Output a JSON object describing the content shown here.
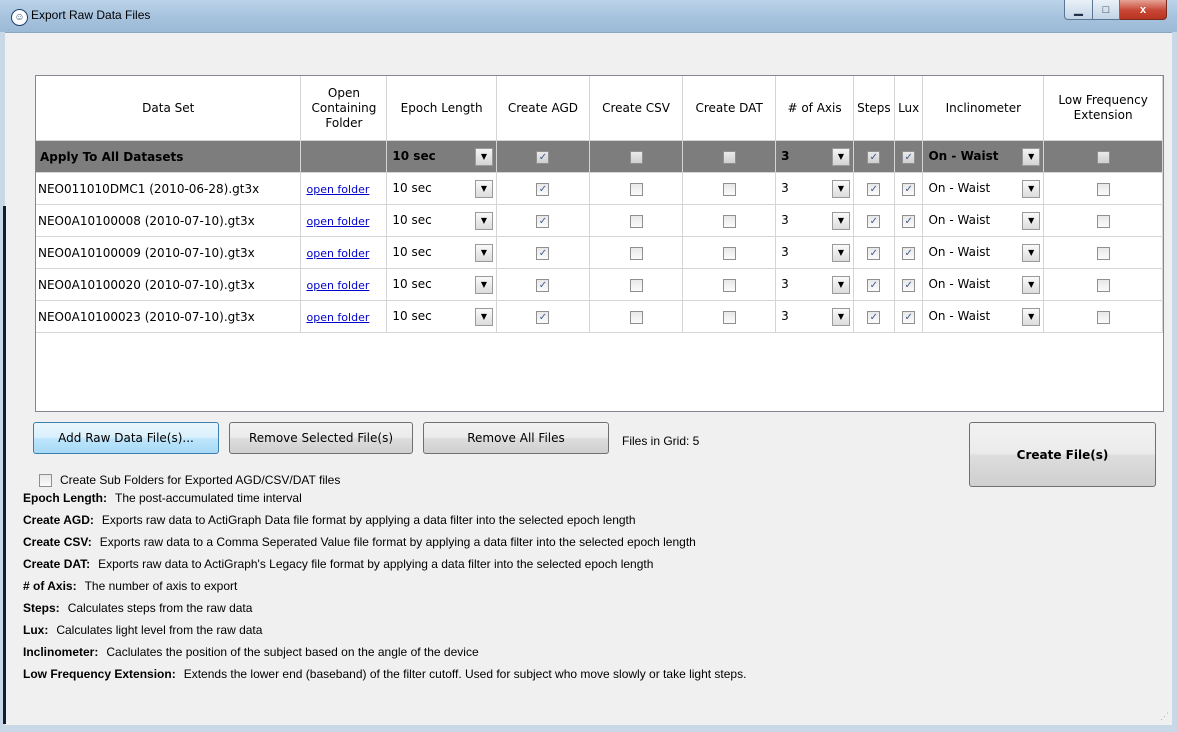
{
  "window": {
    "title": "Export Raw Data Files",
    "buttons": {
      "minimize": "▁",
      "maximize": "□",
      "close": "x"
    }
  },
  "grid": {
    "columns": [
      "Data Set",
      "Open Containing Folder",
      "Epoch Length",
      "Create AGD",
      "Create CSV",
      "Create DAT",
      "# of Axis",
      "Steps",
      "Lux",
      "Inclinometer",
      "Low Frequency Extension"
    ],
    "apply_row": {
      "name": "Apply To All Datasets",
      "epoch": "10 sec",
      "agd": true,
      "csv": false,
      "dat": false,
      "axis": "3",
      "steps": true,
      "lux": true,
      "inclinometer": "On - Waist",
      "lfe": false
    },
    "rows": [
      {
        "name": "NEO011010DMC1 (2010-06-28).gt3x",
        "folder": "open folder",
        "epoch": "10 sec",
        "agd": true,
        "csv": false,
        "dat": false,
        "axis": "3",
        "steps": true,
        "lux": true,
        "inclinometer": "On - Waist",
        "lfe": false
      },
      {
        "name": "NEO0A10100008 (2010-07-10).gt3x",
        "folder": "open folder",
        "epoch": "10 sec",
        "agd": true,
        "csv": false,
        "dat": false,
        "axis": "3",
        "steps": true,
        "lux": true,
        "inclinometer": "On - Waist",
        "lfe": false
      },
      {
        "name": "NEO0A10100009 (2010-07-10).gt3x",
        "folder": "open folder",
        "epoch": "10 sec",
        "agd": true,
        "csv": false,
        "dat": false,
        "axis": "3",
        "steps": true,
        "lux": true,
        "inclinometer": "On - Waist",
        "lfe": false
      },
      {
        "name": "NEO0A10100020 (2010-07-10).gt3x",
        "folder": "open folder",
        "epoch": "10 sec",
        "agd": true,
        "csv": false,
        "dat": false,
        "axis": "3",
        "steps": true,
        "lux": true,
        "inclinometer": "On - Waist",
        "lfe": false
      },
      {
        "name": "NEO0A10100023 (2010-07-10).gt3x",
        "folder": "open folder",
        "epoch": "10 sec",
        "agd": true,
        "csv": false,
        "dat": false,
        "axis": "3",
        "steps": true,
        "lux": true,
        "inclinometer": "On - Waist",
        "lfe": false
      }
    ]
  },
  "actions": {
    "add": "Add Raw Data File(s)...",
    "remove_selected": "Remove Selected File(s)",
    "remove_all": "Remove All Files",
    "files_in_grid": "Files in Grid: 5",
    "create": "Create File(s)"
  },
  "options": {
    "subfolders_label": "Create Sub Folders for Exported AGD/CSV/DAT files",
    "subfolders_checked": false
  },
  "help": [
    {
      "term": "Epoch Length:",
      "desc": "The post-accumulated time interval"
    },
    {
      "term": "Create AGD:",
      "desc": "Exports raw data to ActiGraph Data file format by applying a data filter into the selected epoch length"
    },
    {
      "term": "Create CSV:",
      "desc": "Exports raw data to a Comma Seperated Value file format by applying a data filter into the selected epoch length"
    },
    {
      "term": "Create DAT:",
      "desc": "Exports raw data to ActiGraph's Legacy file format by applying a data filter into the selected epoch length"
    },
    {
      "term": "# of Axis:",
      "desc": "The number of axis to export"
    },
    {
      "term": "Steps:",
      "desc": "Calculates steps from the raw data"
    },
    {
      "term": "Lux:",
      "desc": "Calculates light level from the raw data"
    },
    {
      "term": "Inclinometer:",
      "desc": "Caclulates the position of the subject based on the angle of the device"
    },
    {
      "term": "Low Frequency Extension:",
      "desc": "Extends the lower end (baseband) of the filter cutoff.  Used for subject who move slowly or take light steps."
    }
  ],
  "colors": {
    "apply_row": "#7d7d7d",
    "link": "#0000cc",
    "title_bar": "#a7c3de",
    "close_button": "#c74634"
  },
  "icons": {
    "app": "actigraph-icon",
    "dropdown": "chevron-down-icon",
    "check": "checkmark-icon"
  }
}
